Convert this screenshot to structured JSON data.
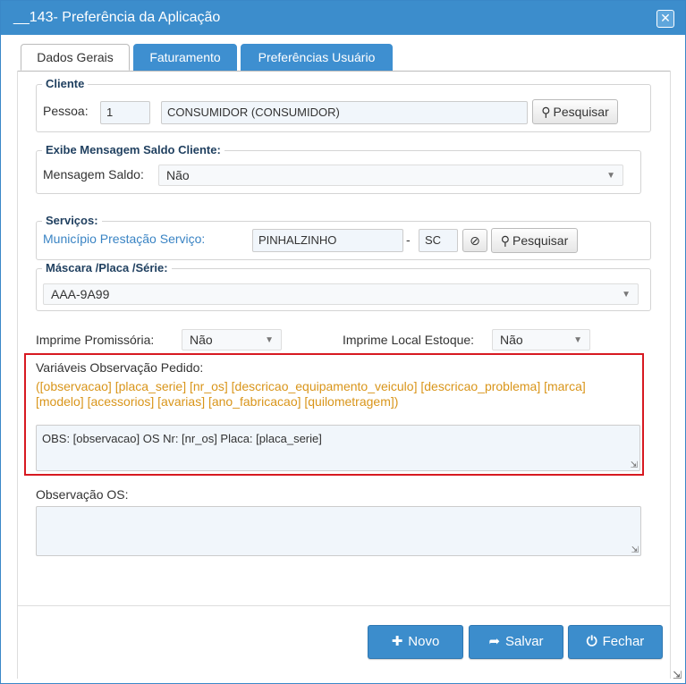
{
  "window": {
    "title": "__143- Preferência da Aplicação",
    "close_symbol": "✕"
  },
  "tabs": [
    {
      "label": "Dados Gerais",
      "active": true
    },
    {
      "label": "Faturamento",
      "active": false
    },
    {
      "label": "Preferências Usuário",
      "active": false
    }
  ],
  "cliente": {
    "legend": "Cliente",
    "pessoa_label": "Pessoa:",
    "pessoa_code": "1",
    "pessoa_name": "CONSUMIDOR (CONSUMIDOR)",
    "search_label": "Pesquisar"
  },
  "mensagem_saldo": {
    "legend": "Exibe Mensagem Saldo Cliente:",
    "label": "Mensagem Saldo:",
    "value": "Não"
  },
  "servicos": {
    "legend": "Serviços:",
    "municipio_label": "Município Prestação Serviço:",
    "municipio_value": "PINHALZINHO",
    "separator": "-",
    "uf_value": "SC",
    "search_label": "Pesquisar"
  },
  "mascara": {
    "legend": "Máscara /Placa /Série:",
    "value": "AAA-9A99"
  },
  "imprime_promissoria": {
    "label": "Imprime Promissória:",
    "value": "Não"
  },
  "imprime_local_estoque": {
    "label": "Imprime Local Estoque:",
    "value": "Não"
  },
  "variaveis": {
    "label": "Variáveis Observação Pedido:",
    "line1": "([observacao] [placa_serie] [nr_os] [descricao_equipamento_veiculo] [descricao_problema] [marca]",
    "line2": "[modelo] [acessorios] [avarias] [ano_fabricacao] [quilometragem])",
    "text": "OBS: [observacao] OS Nr: [nr_os]  Placa: [placa_serie]"
  },
  "observacao_os": {
    "label": "Observação OS:",
    "text": ""
  },
  "buttons": {
    "novo": "Novo",
    "salvar": "Salvar",
    "fechar": "Fechar"
  },
  "colors": {
    "accent": "#3c8dcc",
    "highlight_border": "#d71921",
    "variables_text": "#d9951a"
  }
}
